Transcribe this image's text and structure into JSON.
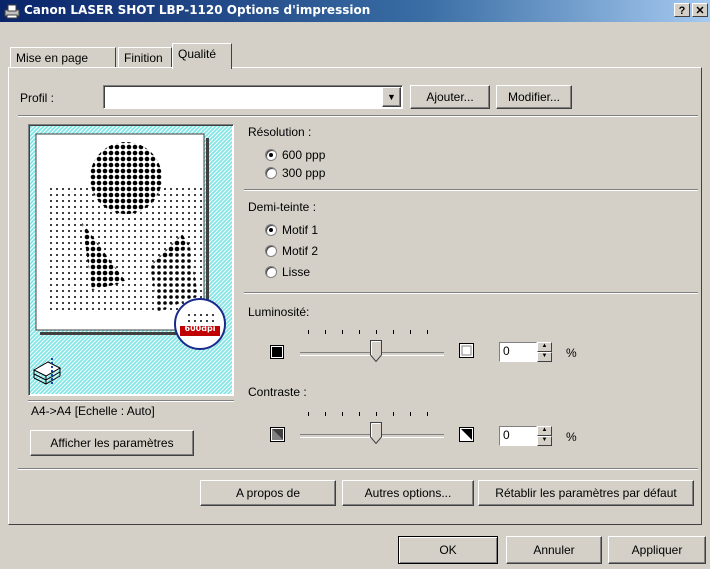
{
  "window": {
    "title": "Canon LASER SHOT LBP-1120 Options d'impression",
    "help_label": "?",
    "close_label": "✕"
  },
  "tabs": [
    {
      "label": "Mise en page"
    },
    {
      "label": "Finition"
    },
    {
      "label": "Qualité"
    }
  ],
  "profile": {
    "label": "Profil :",
    "value": "",
    "add_label": "Ajouter...",
    "modify_label": "Modifier..."
  },
  "preview": {
    "badge": "600dpi",
    "paper_info": "A4->A4 [Echelle : Auto]",
    "show_settings_label": "Afficher les paramètres"
  },
  "resolution": {
    "label": "Résolution :",
    "options": [
      {
        "label": "600 ppp",
        "selected": true
      },
      {
        "label": "300 ppp",
        "selected": false
      }
    ]
  },
  "halftone": {
    "label": "Demi-teinte :",
    "options": [
      {
        "label": "Motif 1",
        "selected": true
      },
      {
        "label": "Motif 2",
        "selected": false
      },
      {
        "label": "Lisse",
        "selected": false
      }
    ]
  },
  "brightness": {
    "label": "Luminosité:",
    "value": "0",
    "unit": "%",
    "slider_level": 0.5
  },
  "contrast": {
    "label": "Contraste :",
    "value": "0",
    "unit": "%",
    "slider_level": 0.5
  },
  "panel_buttons": {
    "about": "A propos de",
    "more_options": "Autres options...",
    "restore_defaults": "Rétablir les paramètres par défaut"
  },
  "dialog_buttons": {
    "ok": "OK",
    "cancel": "Annuler",
    "apply": "Appliquer"
  }
}
